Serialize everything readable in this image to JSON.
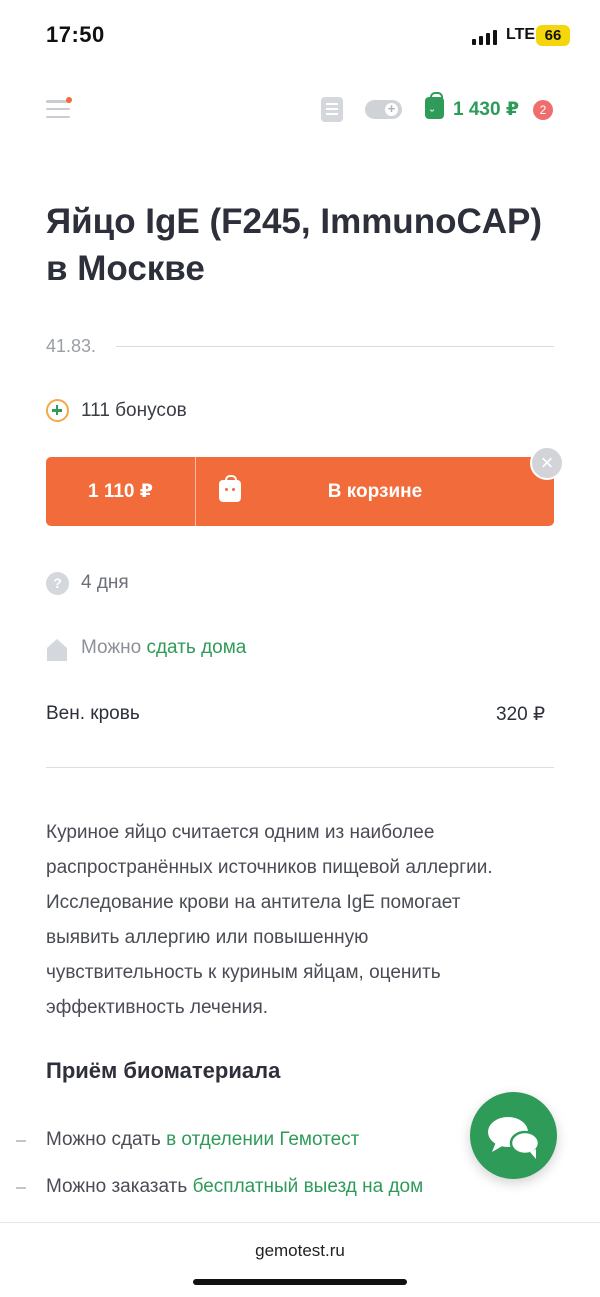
{
  "status_bar": {
    "time": "17:50",
    "network": "LTE",
    "battery": "66"
  },
  "header": {
    "cart_total": "1 430 ₽",
    "cart_count": "2"
  },
  "product": {
    "title": "Яйцо IgE (F245, ImmunoCAP) в Москве",
    "code": "41.83.",
    "bonus": "111 бонусов",
    "price": "1 110 ₽",
    "cart_button_label": "В корзине",
    "duration": "4 дня",
    "home_prefix": "Можно",
    "home_link": "сдать дома",
    "biomaterial": "Вен. кровь",
    "biomaterial_price": "320 ₽",
    "description": "Куриное яйцо считается одним из наиболее распространённых источников пищевой аллергии. Исследование крови на антитела IgE помогает выявить аллергию или повышенную чувствительность к куриным яйцам, оценить эффективность лечения."
  },
  "intake": {
    "heading": "Приём биоматериала",
    "items": [
      {
        "prefix": "Можно сдать",
        "link": "в отделении Гемотест"
      },
      {
        "prefix": "Можно заказать",
        "link": "бесплатный выезд на дом"
      }
    ]
  },
  "browser": {
    "url": "gemotest.ru"
  },
  "colors": {
    "accent": "#f26b3a",
    "brand": "#2e9b58",
    "badge": "#ee6e6e"
  }
}
